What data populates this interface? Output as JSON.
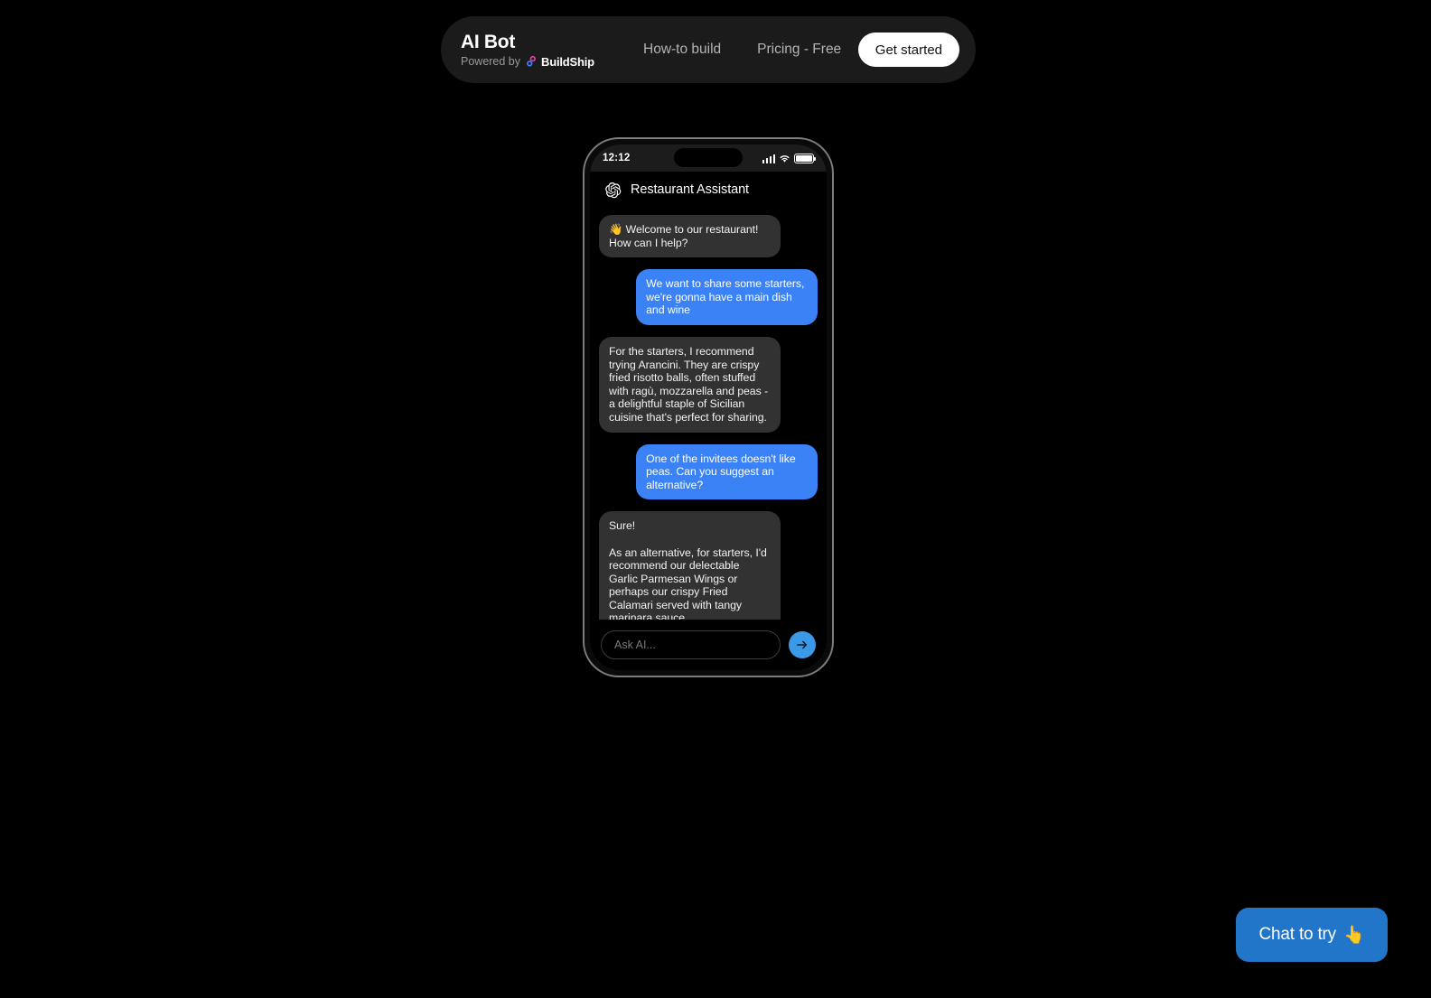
{
  "navbar": {
    "brand_title": "AI Bot",
    "powered_by_label": "Powered by",
    "powered_by_brand": "BuildShip",
    "links": [
      {
        "label": "How-to build"
      },
      {
        "label": "Pricing - Free"
      }
    ],
    "cta_label": "Get started"
  },
  "phone": {
    "status_bar": {
      "time": "12:12",
      "signal_icon": "cellular-signal-icon",
      "wifi_icon": "wifi-icon",
      "battery_icon": "battery-full-icon"
    },
    "app_header": {
      "logo_icon": "openai-logo-icon",
      "title": "Restaurant Assistant"
    },
    "messages": [
      {
        "sender": "bot",
        "text": "👋 Welcome to our restaurant! How can I help?"
      },
      {
        "sender": "user",
        "text": "We want to share some starters, we're gonna have a main dish and wine"
      },
      {
        "sender": "bot",
        "text": "For the starters, I recommend trying Arancini. They are crispy fried risotto balls, often stuffed with ragù, mozzarella and peas - a delightful staple of Sicilian cuisine that's perfect for sharing."
      },
      {
        "sender": "user",
        "text": "One of the invitees doesn't like peas. Can you suggest an alternative?"
      },
      {
        "sender": "bot",
        "text": "Sure!\n\nAs an alternative, for starters, I'd recommend our delectable Garlic Parmesan Wings or perhaps our crispy Fried Calamari served with tangy marinara sauce.\n\nAs for the main course, you can't go wrong with our succulent Grilled"
      }
    ],
    "input": {
      "value": "",
      "placeholder": "Ask AI...",
      "send_icon": "arrow-right-icon"
    }
  },
  "floating_button": {
    "label": "Chat to try",
    "emoji": "👆"
  },
  "colors": {
    "page_background": "#000000",
    "navbar_background": "#1b1b1b",
    "user_bubble": "#3b82f6",
    "bot_bubble": "#333233",
    "fab_background": "#2176ca",
    "send_button": "#3b9ae8",
    "cta_background": "#ffffff"
  }
}
